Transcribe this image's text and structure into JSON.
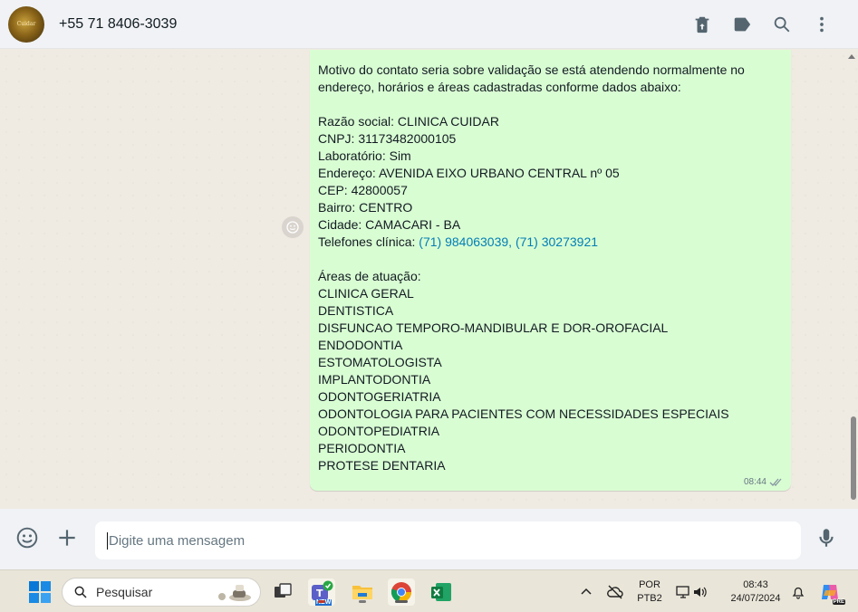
{
  "header": {
    "contact_name": "+55 71 8406-3039",
    "avatar_text": "Cuidar",
    "actions": [
      "delete-icon",
      "label-icon",
      "search-icon",
      "menu-icon"
    ]
  },
  "message": {
    "lines": [
      "Motivo do contato seria sobre validação se está atendendo normalmente no",
      "endereço, horários e áreas cadastradas conforme dados abaixo:",
      "",
      "Razão social: CLINICA CUIDAR",
      "CNPJ: 31173482000105",
      "Laboratório: Sim",
      "Endereço: AVENIDA EIXO URBANO CENTRAL nº 05",
      "CEP: 42800057",
      "Bairro: CENTRO",
      "Cidade: CAMACARI - BA",
      "",
      "",
      "Áreas de atuação:",
      "CLINICA GERAL",
      "DENTISTICA",
      "DISFUNCAO TEMPORO-MANDIBULAR E DOR-OROFACIAL",
      "ENDODONTIA",
      "ESTOMATOLOGISTA",
      "IMPLANTODONTIA",
      "ODONTOGERIATRIA",
      "ODONTOLOGIA PARA PACIENTES COM NECESSIDADES ESPECIAIS",
      "ODONTOPEDIATRIA",
      "PERIODONTIA",
      "PROTESE DENTARIA"
    ],
    "phones_label": "Telefones clínica: ",
    "phones_link": "(71) 984063039, (71) 30273921",
    "time": "08:44",
    "status": "double-check-icon"
  },
  "composer": {
    "placeholder": "Digite uma mensagem"
  },
  "taskbar": {
    "search_placeholder": "Pesquisar",
    "lang_top": "POR",
    "lang_bottom": "PTB2",
    "clock_time": "08:43",
    "clock_date": "24/07/2024",
    "teams_badge": "NEW",
    "copilot_badge": "PRE"
  },
  "colors": {
    "bubble": "#d9fdd3",
    "chat_bg": "#efeae2",
    "link": "#027eb5",
    "header_bg": "#f0f2f5"
  }
}
